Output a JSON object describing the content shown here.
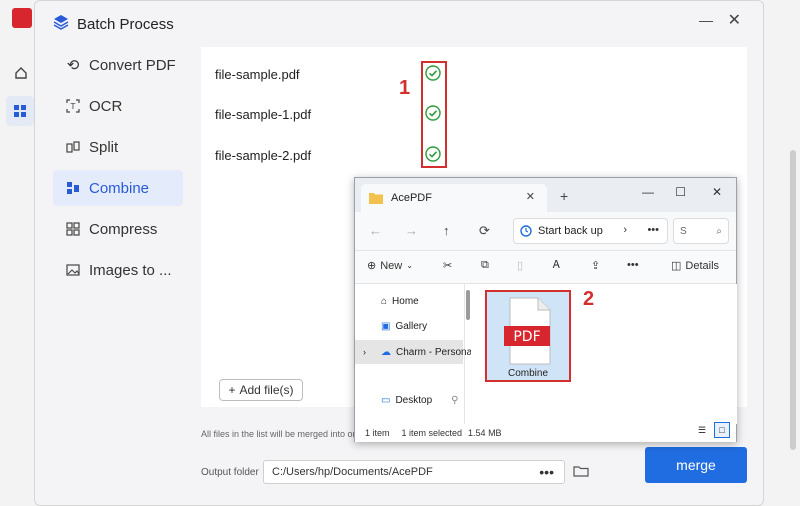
{
  "dialog": {
    "title": "Batch Process"
  },
  "sidebar": {
    "items": [
      {
        "label": "Convert PDF",
        "icon": "convert-icon"
      },
      {
        "label": "OCR",
        "icon": "ocr-icon"
      },
      {
        "label": "Split",
        "icon": "split-icon"
      },
      {
        "label": "Combine",
        "icon": "combine-icon",
        "active": true
      },
      {
        "label": "Compress",
        "icon": "compress-icon"
      },
      {
        "label": "Images to ...",
        "icon": "images-icon"
      }
    ]
  },
  "files": [
    {
      "name": "file-sample.pdf",
      "status": "check"
    },
    {
      "name": "file-sample-1.pdf",
      "status": "check"
    },
    {
      "name": "file-sample-2.pdf",
      "status": "check"
    }
  ],
  "annotations": {
    "marker1": "1",
    "marker2": "2"
  },
  "add_button": "Add file(s)",
  "note": "All files in the list will be merged into or",
  "output": {
    "label": "Output folder",
    "path": "C:/Users/hp/Documents/AcePDF"
  },
  "merge_button": "merge",
  "explorer": {
    "tab_title": "AcePDF",
    "address": "Start back up",
    "search_placeholder": "S",
    "commands": {
      "new": "New",
      "details": "Details"
    },
    "nav": [
      {
        "label": "Home"
      },
      {
        "label": "Gallery"
      },
      {
        "label": "Charm - Persona"
      },
      {
        "label": "Desktop"
      }
    ],
    "item": {
      "name": "Combine",
      "badge": "PDF"
    },
    "status": {
      "count": "1 item",
      "selected": "1 item selected",
      "size": "1.54 MB"
    }
  },
  "colors": {
    "accent": "#1f6de0",
    "highlight": "#d32f2f",
    "pdf_red": "#d8262e"
  }
}
